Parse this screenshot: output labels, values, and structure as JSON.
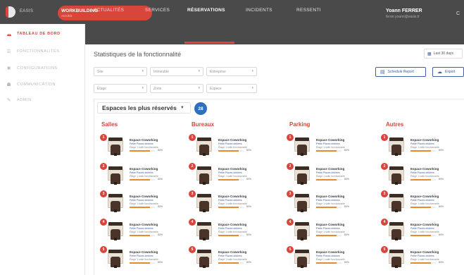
{
  "app": {
    "brand": "EASIS",
    "site_name": "WORKBUILDING",
    "site_sub": "ACCÈS"
  },
  "user": {
    "name": "Yoann FERRER",
    "email": "ferrer.yoann@easis.fr",
    "extra": "C"
  },
  "sidebar": {
    "items": [
      {
        "label": "TABLEAU DE BORD",
        "icon": "dashboard-icon",
        "active": true
      },
      {
        "label": "FONCTIONNALITÉS",
        "icon": "list-icon",
        "active": false
      },
      {
        "label": "CONFIGURATIONS",
        "icon": "gear-icon",
        "active": false
      },
      {
        "label": "COMMUNICATION",
        "icon": "people-icon",
        "active": false
      },
      {
        "label": "ADMIN",
        "icon": "wrench-icon",
        "active": false
      }
    ]
  },
  "tabs": [
    "ACTUALITÉS",
    "SERVICES",
    "RÉSERVATIONS",
    "INCIDENTS",
    "RESSENTI"
  ],
  "active_tab": "RÉSERVATIONS",
  "stats": {
    "title": "Statistiques de la fonctionnalité",
    "period_button": "Last 30 days",
    "report_button": "Schedule Report",
    "export_button": "Export"
  },
  "filters": {
    "row1": [
      "Site",
      "Immeuble",
      "Entreprise"
    ],
    "row2": [
      "Étage",
      "Zone",
      "Espace"
    ]
  },
  "spaces": {
    "selector": "Espaces les plus réservés",
    "count": "28",
    "columns": [
      "Salles",
      "Bureaux",
      "Parking",
      "Autres"
    ],
    "item_name": "Espace Coworking",
    "item_line2": "Petite Places dédiées",
    "item_line3": "Étage 1 salle fonctionnelle",
    "item_pct": "80%",
    "item_fill": 0.8,
    "ranks": [
      "1",
      "2",
      "3",
      "4",
      "5"
    ]
  },
  "colors": {
    "accent": "#d8453a",
    "blue": "#2f6fc0",
    "dark": "#4a4a4a"
  }
}
